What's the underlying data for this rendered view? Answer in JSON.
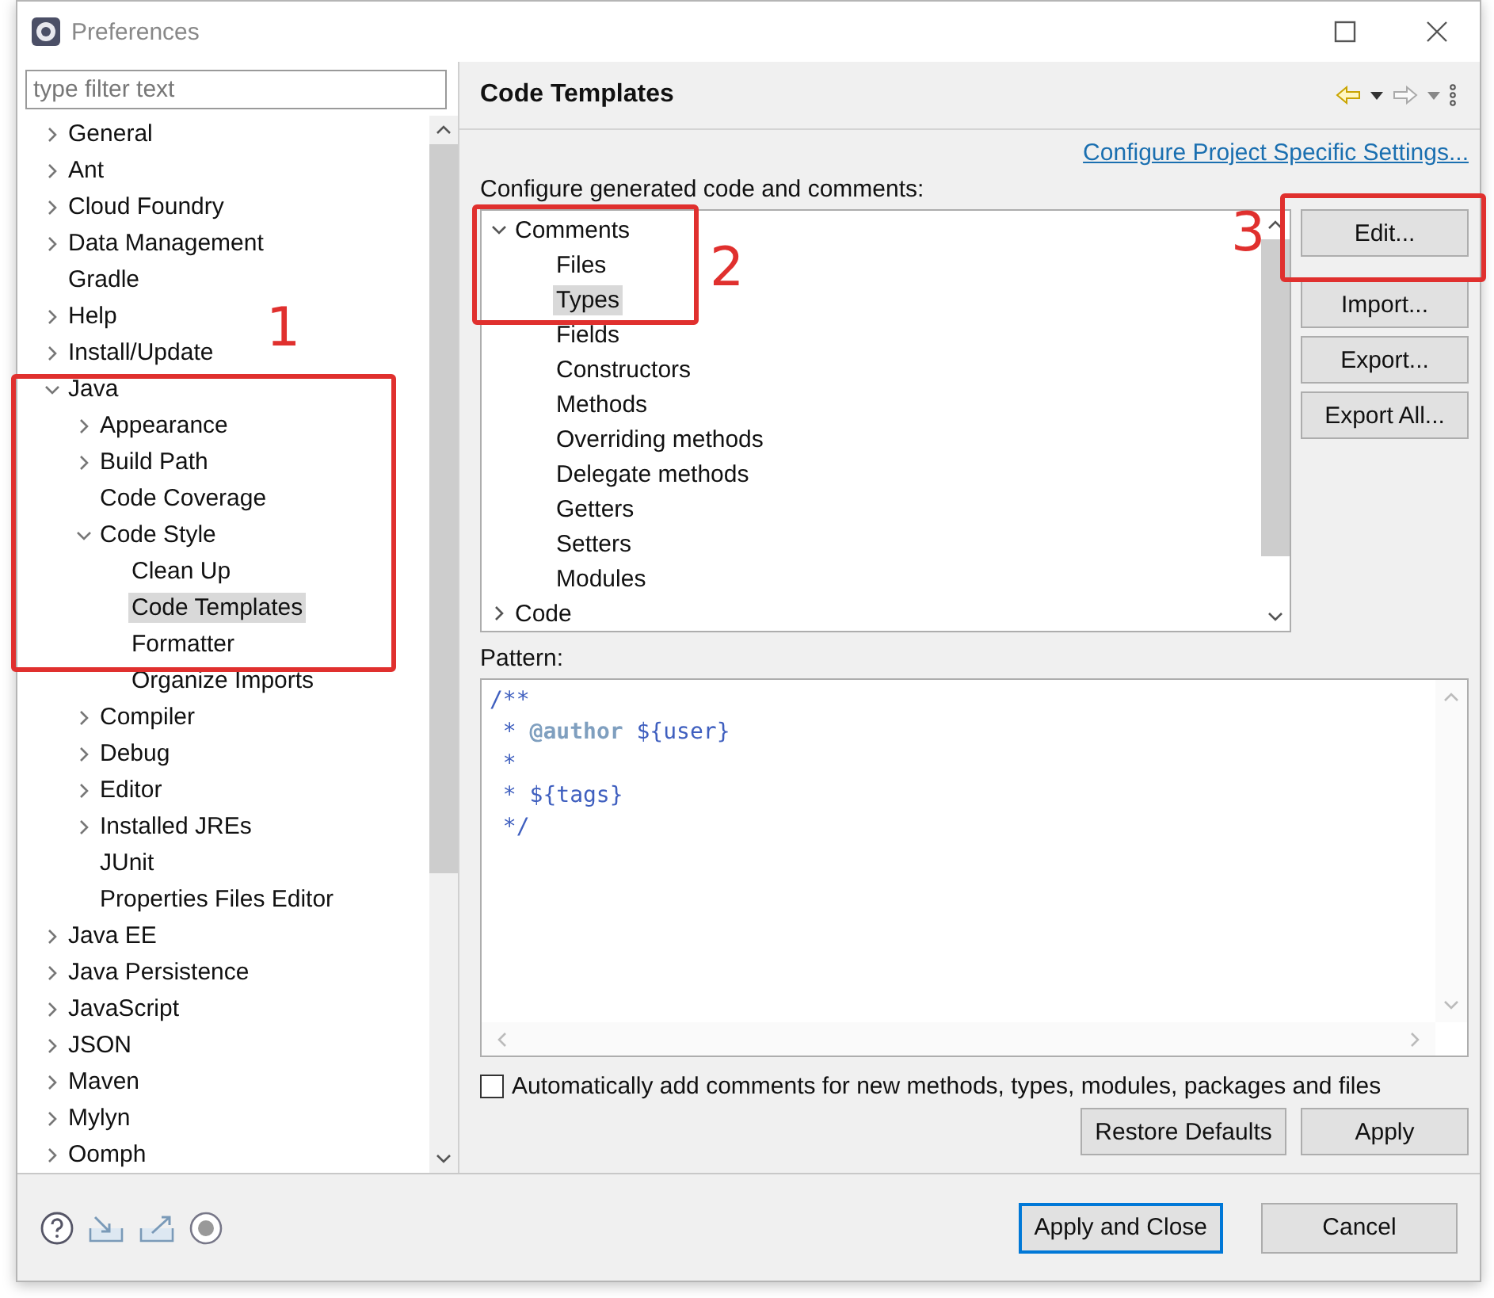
{
  "window": {
    "title": "Preferences"
  },
  "filter": {
    "placeholder": "type filter text"
  },
  "nav_tree": [
    {
      "label": "General",
      "expandable": true,
      "expanded": false,
      "selected": false
    },
    {
      "label": "Ant",
      "expandable": true,
      "expanded": false,
      "selected": false
    },
    {
      "label": "Cloud Foundry",
      "expandable": true,
      "expanded": false,
      "selected": false
    },
    {
      "label": "Data Management",
      "expandable": true,
      "expanded": false,
      "selected": false
    },
    {
      "label": "Gradle",
      "expandable": false,
      "selected": false
    },
    {
      "label": "Help",
      "expandable": true,
      "expanded": false,
      "selected": false
    },
    {
      "label": "Install/Update",
      "expandable": true,
      "expanded": false,
      "selected": false
    },
    {
      "label": "Java",
      "expandable": true,
      "expanded": true,
      "selected": false,
      "children": [
        {
          "label": "Appearance",
          "expandable": true,
          "expanded": false,
          "selected": false
        },
        {
          "label": "Build Path",
          "expandable": true,
          "expanded": false,
          "selected": false
        },
        {
          "label": "Code Coverage",
          "expandable": false,
          "selected": false
        },
        {
          "label": "Code Style",
          "expandable": true,
          "expanded": true,
          "selected": false,
          "children": [
            {
              "label": "Clean Up",
              "expandable": false,
              "selected": false
            },
            {
              "label": "Code Templates",
              "expandable": false,
              "selected": true
            },
            {
              "label": "Formatter",
              "expandable": false,
              "selected": false
            },
            {
              "label": "Organize Imports",
              "expandable": false,
              "selected": false
            }
          ]
        },
        {
          "label": "Compiler",
          "expandable": true,
          "expanded": false,
          "selected": false
        },
        {
          "label": "Debug",
          "expandable": true,
          "expanded": false,
          "selected": false
        },
        {
          "label": "Editor",
          "expandable": true,
          "expanded": false,
          "selected": false
        },
        {
          "label": "Installed JREs",
          "expandable": true,
          "expanded": false,
          "selected": false
        },
        {
          "label": "JUnit",
          "expandable": false,
          "selected": false
        },
        {
          "label": "Properties Files Editor",
          "expandable": false,
          "selected": false
        }
      ]
    },
    {
      "label": "Java EE",
      "expandable": true,
      "expanded": false,
      "selected": false
    },
    {
      "label": "Java Persistence",
      "expandable": true,
      "expanded": false,
      "selected": false
    },
    {
      "label": "JavaScript",
      "expandable": true,
      "expanded": false,
      "selected": false
    },
    {
      "label": "JSON",
      "expandable": true,
      "expanded": false,
      "selected": false
    },
    {
      "label": "Maven",
      "expandable": true,
      "expanded": false,
      "selected": false
    },
    {
      "label": "Mylyn",
      "expandable": true,
      "expanded": false,
      "selected": false
    },
    {
      "label": "Oomph",
      "expandable": true,
      "expanded": false,
      "selected": false
    }
  ],
  "page": {
    "title": "Code Templates",
    "link": "Configure Project Specific Settings...",
    "templates_label": "Configure generated code and comments:",
    "templates_tree": [
      {
        "label": "Comments",
        "expandable": true,
        "expanded": true,
        "selected": false,
        "children": [
          {
            "label": "Files",
            "expandable": false,
            "selected": false
          },
          {
            "label": "Types",
            "expandable": false,
            "selected": true
          },
          {
            "label": "Fields",
            "expandable": false,
            "selected": false
          },
          {
            "label": "Constructors",
            "expandable": false,
            "selected": false
          },
          {
            "label": "Methods",
            "expandable": false,
            "selected": false
          },
          {
            "label": "Overriding methods",
            "expandable": false,
            "selected": false
          },
          {
            "label": "Delegate methods",
            "expandable": false,
            "selected": false
          },
          {
            "label": "Getters",
            "expandable": false,
            "selected": false
          },
          {
            "label": "Setters",
            "expandable": false,
            "selected": false
          },
          {
            "label": "Modules",
            "expandable": false,
            "selected": false
          }
        ]
      },
      {
        "label": "Code",
        "expandable": true,
        "expanded": false,
        "selected": false
      }
    ],
    "side_buttons": [
      "Edit...",
      "Import...",
      "Export...",
      "Export All..."
    ],
    "pattern_label": "Pattern:",
    "pattern_lines": [
      "/**",
      " * **@author** ${user}",
      " *",
      " * ${tags}",
      " */"
    ],
    "auto_comments": {
      "label": "Automatically add comments for new methods, types, modules, packages and files",
      "checked": false
    },
    "page_buttons": [
      "Restore Defaults",
      "Apply"
    ]
  },
  "footer_buttons": [
    {
      "label": "Apply and Close",
      "default": true
    },
    {
      "label": "Cancel",
      "default": false
    }
  ],
  "annotations": [
    {
      "number": "1"
    },
    {
      "number": "2"
    },
    {
      "number": "3"
    }
  ]
}
